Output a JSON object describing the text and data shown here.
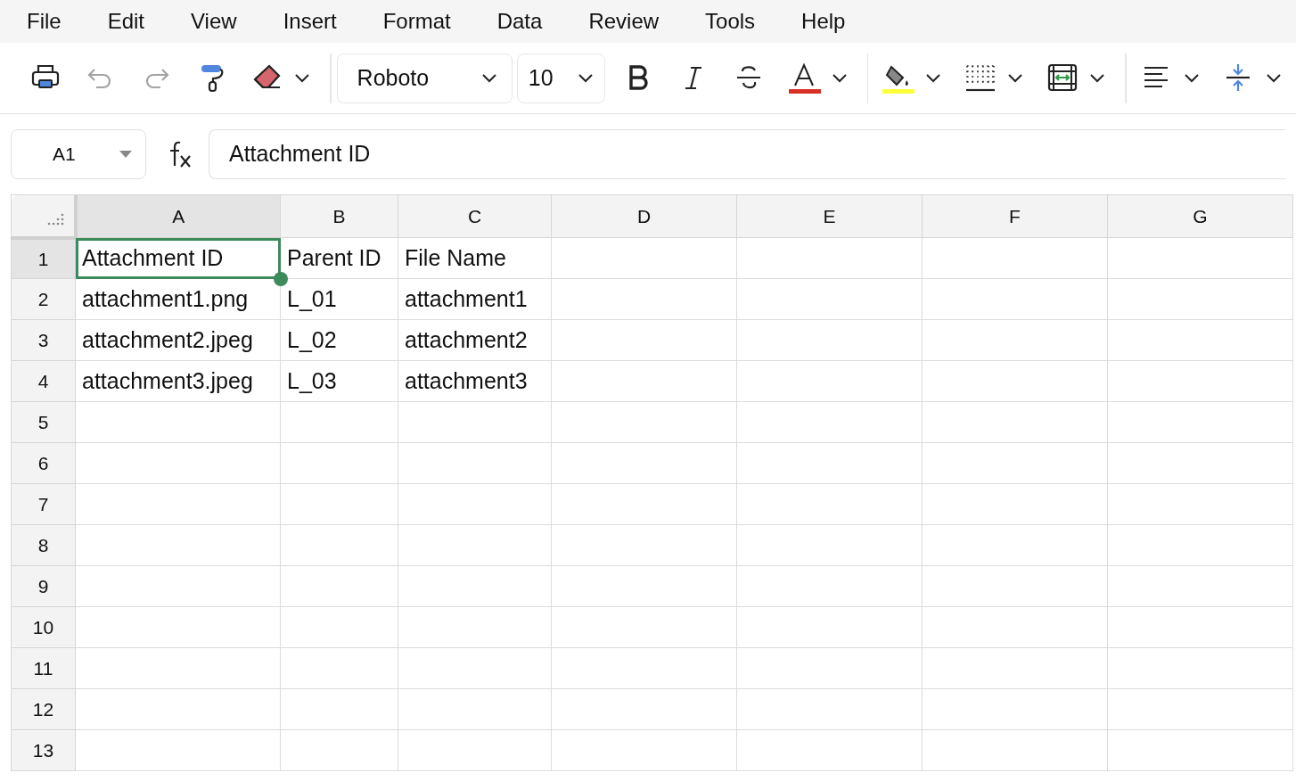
{
  "menu": [
    "File",
    "Edit",
    "View",
    "Insert",
    "Format",
    "Data",
    "Review",
    "Tools",
    "Help"
  ],
  "toolbar": [
    {
      "kind": "print",
      "disabled": false,
      "dropdown": false
    },
    {
      "kind": "undo",
      "disabled": true,
      "dropdown": false
    },
    {
      "kind": "redo",
      "disabled": true,
      "dropdown": false
    },
    {
      "kind": "paint-format",
      "disabled": false,
      "dropdown": false
    },
    {
      "kind": "clear",
      "disabled": false,
      "dropdown": true
    },
    {
      "kind": "separator"
    },
    {
      "kind": "font",
      "value": "Roboto"
    },
    {
      "kind": "size",
      "value": "10"
    },
    {
      "kind": "bold",
      "disabled": false,
      "dropdown": false
    },
    {
      "kind": "italic",
      "disabled": false,
      "dropdown": false
    },
    {
      "kind": "strike",
      "disabled": false,
      "dropdown": false
    },
    {
      "kind": "text-color",
      "disabled": false,
      "dropdown": true,
      "color": "#d93025"
    },
    {
      "kind": "separator"
    },
    {
      "kind": "fill-color",
      "disabled": false,
      "dropdown": true,
      "color": "#ffff3d"
    },
    {
      "kind": "borders",
      "disabled": false,
      "dropdown": true
    },
    {
      "kind": "merge",
      "disabled": false,
      "dropdown": true
    },
    {
      "kind": "separator"
    },
    {
      "kind": "align",
      "disabled": false,
      "dropdown": true
    },
    {
      "kind": "valign",
      "disabled": false,
      "dropdown": true
    }
  ],
  "name_box": "A1",
  "formula": "Attachment ID",
  "columns": [
    {
      "label": "A",
      "selected": true
    },
    {
      "label": "B",
      "selected": false
    },
    {
      "label": "C",
      "selected": false
    },
    {
      "label": "D",
      "selected": false
    },
    {
      "label": "E",
      "selected": false
    },
    {
      "label": "F",
      "selected": false
    },
    {
      "label": "G",
      "selected": false
    }
  ],
  "rows": [
    {
      "label": "1",
      "selected": true,
      "cells": [
        {
          "text": "Attachment ID",
          "selected": true
        },
        {
          "text": "Parent ID",
          "selected": false
        },
        {
          "text": "File Name",
          "selected": false
        }
      ]
    },
    {
      "label": "2",
      "selected": false,
      "cells": [
        {
          "text": "attachment1.png",
          "selected": false
        },
        {
          "text": "L_01",
          "selected": false
        },
        {
          "text": "attachment1",
          "selected": false
        }
      ]
    },
    {
      "label": "3",
      "selected": false,
      "cells": [
        {
          "text": "attachment2.jpeg",
          "selected": false
        },
        {
          "text": "L_02",
          "selected": false
        },
        {
          "text": "attachment2",
          "selected": false
        }
      ]
    },
    {
      "label": "4",
      "selected": false,
      "cells": [
        {
          "text": "attachment3.jpeg",
          "selected": false
        },
        {
          "text": "L_03",
          "selected": false
        },
        {
          "text": "attachment3",
          "selected": false
        }
      ]
    },
    {
      "label": "5",
      "selected": false,
      "cells": []
    },
    {
      "label": "6",
      "selected": false,
      "cells": []
    },
    {
      "label": "7",
      "selected": false,
      "cells": []
    },
    {
      "label": "8",
      "selected": false,
      "cells": []
    },
    {
      "label": "9",
      "selected": false,
      "cells": []
    },
    {
      "label": "10",
      "selected": false,
      "cells": []
    },
    {
      "label": "11",
      "selected": false,
      "cells": []
    },
    {
      "label": "12",
      "selected": false,
      "cells": []
    },
    {
      "label": "13",
      "selected": false,
      "cells": []
    }
  ]
}
